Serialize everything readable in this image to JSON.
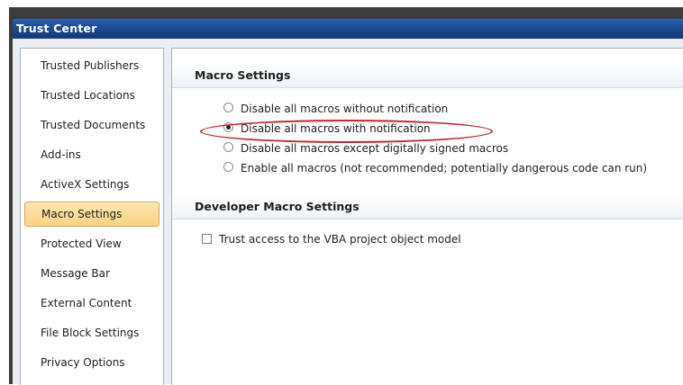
{
  "window": {
    "title": "Trust Center"
  },
  "sidebar": {
    "items": [
      {
        "label": "Trusted Publishers"
      },
      {
        "label": "Trusted Locations"
      },
      {
        "label": "Trusted Documents"
      },
      {
        "label": "Add-ins"
      },
      {
        "label": "ActiveX Settings"
      },
      {
        "label": "Macro Settings",
        "active": true
      },
      {
        "label": "Protected View"
      },
      {
        "label": "Message Bar"
      },
      {
        "label": "External Content"
      },
      {
        "label": "File Block Settings"
      },
      {
        "label": "Privacy Options"
      }
    ]
  },
  "macro_settings": {
    "header": "Macro Settings",
    "options": [
      {
        "label": "Disable all macros without notification",
        "selected": false
      },
      {
        "label": "Disable all macros with notification",
        "selected": true
      },
      {
        "label": "Disable all macros except digitally signed macros",
        "selected": false
      },
      {
        "label": "Enable all macros (not recommended; potentially dangerous code can run)",
        "selected": false
      }
    ]
  },
  "developer_settings": {
    "header": "Developer Macro Settings",
    "trust_vba_label": "Trust access to the VBA project object model",
    "trust_vba_checked": false
  },
  "colors": {
    "title_bar": "#1b4a92",
    "active_item": "#fbd27f",
    "highlight_oval": "#c0272d"
  }
}
